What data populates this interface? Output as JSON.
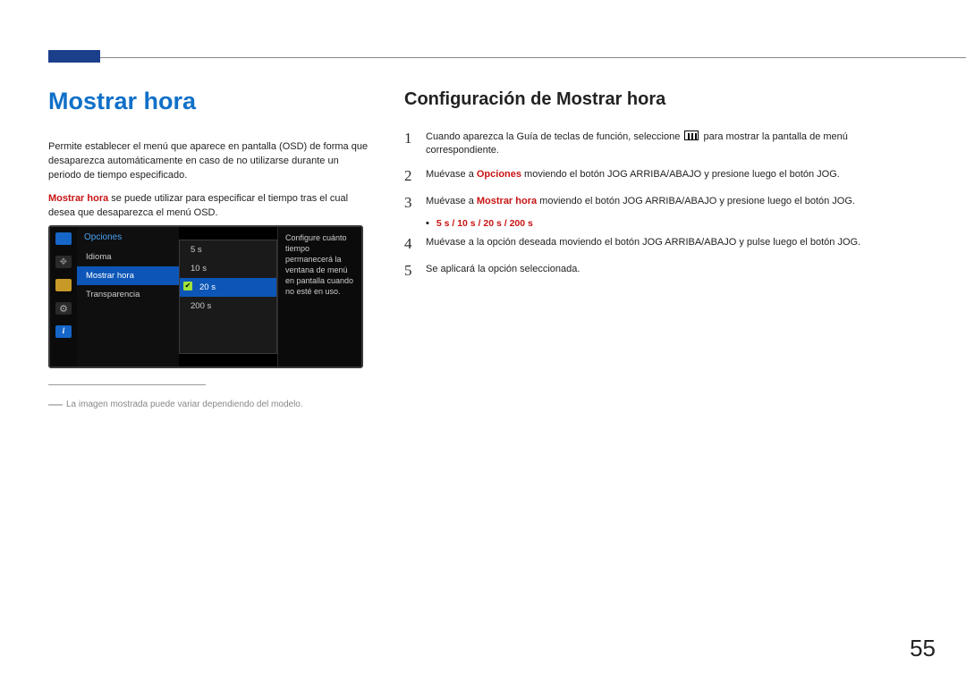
{
  "page_number": "55",
  "title": "Mostrar hora",
  "subtitle": "Configuración de Mostrar hora",
  "intro": {
    "p1": "Permite establecer el menú que aparece en pantalla (OSD) de forma que desaparezca automáticamente en caso de no utilizarse durante un periodo de tiempo especificado.",
    "p2_a": "Mostrar hora",
    "p2_b": " se puede utilizar para especificar el tiempo tras el cual desea que desaparezca el menú OSD."
  },
  "osd": {
    "header": "Opciones",
    "items": [
      "Idioma",
      "Mostrar hora",
      "Transparencia"
    ],
    "selected_index": 1,
    "sub_options": [
      "5 s",
      "10 s",
      "20 s",
      "200 s"
    ],
    "sub_selected_index": 2,
    "desc": "Configure cuánto tiempo permanecerá la ventana de menú en pantalla cuando no esté en uso.",
    "icons": {
      "mon": "monitor-icon",
      "move": "move-icon",
      "eq": "eq-icon",
      "gear": "gear-icon",
      "info": "info-icon",
      "gear_glyph": "⚙",
      "info_glyph": "i",
      "move_glyph": "✥"
    }
  },
  "footnote": "La imagen mostrada puede variar dependiendo del modelo.",
  "steps": [
    {
      "n": "1",
      "pre": "Cuando aparezca la Guía de teclas de función, seleccione ",
      "post": " para mostrar la pantalla de menú correspondiente."
    },
    {
      "n": "2",
      "pre": "Muévase a ",
      "hl": "Opciones",
      "post": " moviendo el botón JOG ARRIBA/ABAJO y presione luego el botón JOG."
    },
    {
      "n": "3",
      "pre": "Muévase a ",
      "hl": "Mostrar hora",
      "post": " moviendo el botón JOG ARRIBA/ABAJO y presione luego el botón JOG."
    },
    {
      "n": "4",
      "text": "Muévase a la opción deseada moviendo el botón JOG ARRIBA/ABAJO y pulse luego el botón JOG."
    },
    {
      "n": "5",
      "text": "Se aplicará la opción seleccionada."
    }
  ],
  "options_line": "5 s / 10 s / 20 s / 200 s"
}
